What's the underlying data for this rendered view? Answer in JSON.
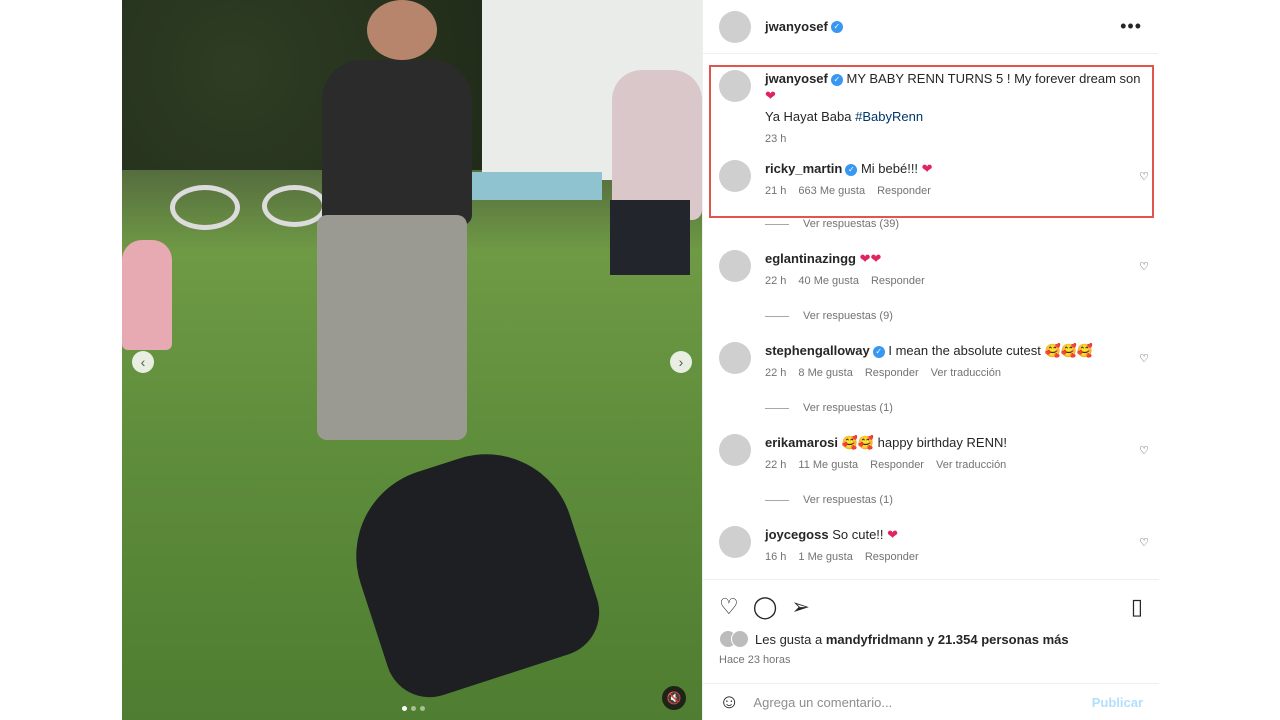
{
  "post": {
    "username": "jwanyosef",
    "more_icon": "more-icon"
  },
  "comments": [
    {
      "username": "jwanyosef",
      "text": "MY BABY RENN TURNS 5 ! My forever dream son",
      "text2": "Ya Hayat Baba",
      "hashtag": "#BabyRenn",
      "time": "23 h"
    },
    {
      "username": "ricky_martin",
      "text": "Mi bebé!!!",
      "time": "21 h",
      "likes": "663 Me gusta",
      "reply": "Responder",
      "view_replies": "Ver respuestas (39)"
    },
    {
      "username": "eglantinazingg",
      "text": "",
      "time": "22 h",
      "likes": "40 Me gusta",
      "reply": "Responder",
      "view_replies": "Ver respuestas (9)"
    },
    {
      "username": "stephengalloway",
      "text": "I mean the absolute cutest",
      "time": "22 h",
      "likes": "8 Me gusta",
      "reply": "Responder",
      "translate": "Ver traducción",
      "view_replies": "Ver respuestas (1)"
    },
    {
      "username": "erikamarosi",
      "text": "happy birthday RENN!",
      "time": "22 h",
      "likes": "11 Me gusta",
      "reply": "Responder",
      "translate": "Ver traducción",
      "view_replies": "Ver respuestas (1)"
    },
    {
      "username": "joycegoss",
      "text": "So cute!!",
      "time": "16 h",
      "likes": "1 Me gusta",
      "reply": "Responder"
    }
  ],
  "likes_summary": {
    "prefix": "Les gusta a",
    "user": "mandyfridmann",
    "suffix": "y 21.354 personas más"
  },
  "posted_time": "Hace 23 horas",
  "comment_box": {
    "placeholder": "Agrega un comentario...",
    "post_label": "Publicar"
  },
  "colors": {
    "highlight": "#e0564f",
    "verified": "#3897f0",
    "heart": "#e0245e"
  }
}
